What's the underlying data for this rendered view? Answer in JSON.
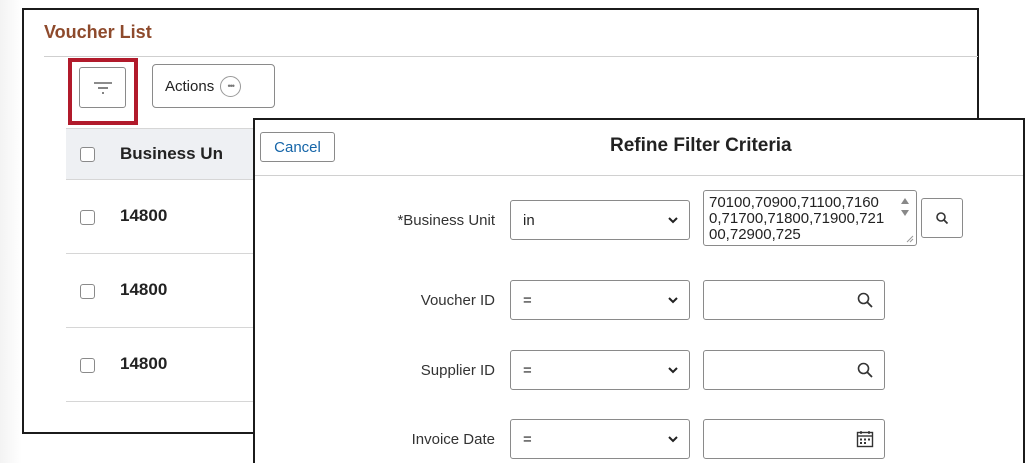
{
  "page": {
    "title": "Voucher List",
    "actions_label": "Actions"
  },
  "grid": {
    "header": "Business Un",
    "rows": [
      {
        "business_unit": "14800"
      },
      {
        "business_unit": "14800"
      },
      {
        "business_unit": "14800"
      }
    ]
  },
  "modal": {
    "cancel_label": "Cancel",
    "title": "Refine Filter Criteria",
    "fields": {
      "business_unit": {
        "label": "*Business Unit",
        "operator": "in",
        "value": "70100,70900,71100,71600,71700,71800,71900,72100,72900,725"
      },
      "voucher_id": {
        "label": "Voucher ID",
        "operator": "=",
        "value": ""
      },
      "supplier_id": {
        "label": "Supplier ID",
        "operator": "=",
        "value": ""
      },
      "invoice_date": {
        "label": "Invoice Date",
        "operator": "=",
        "value": ""
      }
    }
  },
  "colors": {
    "title_brown": "#8e4a2c",
    "highlight_red": "#b11a2b",
    "link_blue": "#1565a8"
  }
}
